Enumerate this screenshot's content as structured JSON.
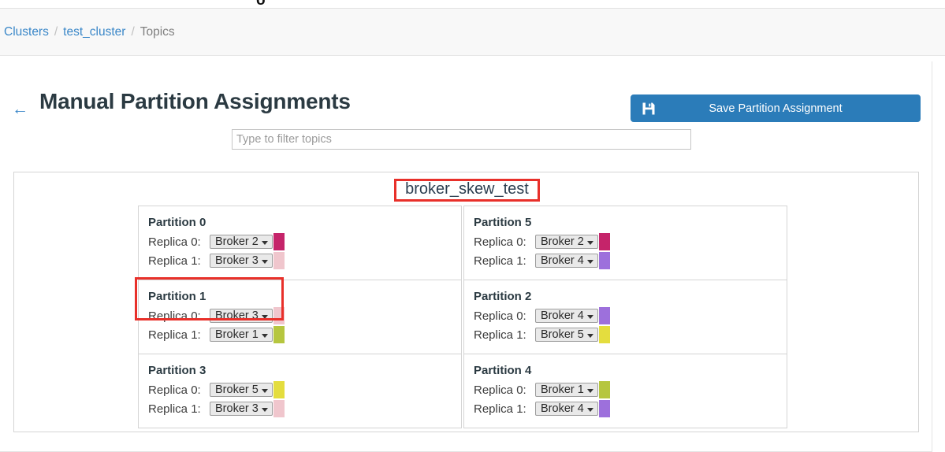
{
  "topnav": {
    "logo_glyph": "o",
    "caret_icon": "chevron-down-icon"
  },
  "breadcrumb": {
    "items": [
      {
        "label": "Clusters",
        "type": "link"
      },
      {
        "label": "test_cluster",
        "type": "link"
      },
      {
        "label": "Topics",
        "type": "current"
      }
    ],
    "separator": "/"
  },
  "header": {
    "back_icon": "←",
    "title": "Manual Partition Assignments",
    "save_button": {
      "label": "Save Partition Assignment",
      "icon": "save-icon",
      "color": "#2b7cb9"
    }
  },
  "filter": {
    "placeholder": "Type to filter topics",
    "value": ""
  },
  "topic": {
    "name": "broker_skew_test",
    "annotated": true,
    "annotation_color": "#e8302a"
  },
  "broker_colors": {
    "Broker 1": "#b6c63f",
    "Broker 2": "#c5246a",
    "Broker 3": "#f0c6cd",
    "Broker 4": "#9d70dc",
    "Broker 5": "#e4dd3e"
  },
  "broker_options": [
    "Broker 1",
    "Broker 2",
    "Broker 3",
    "Broker 4",
    "Broker 5"
  ],
  "columns": [
    {
      "side": "left",
      "partitions": [
        {
          "title": "Partition 0",
          "annotated": false,
          "replicas": [
            {
              "label": "Replica 0:",
              "broker": "Broker 2",
              "color": "#c5246a"
            },
            {
              "label": "Replica 1:",
              "broker": "Broker 3",
              "color": "#f0c6cd"
            }
          ]
        },
        {
          "title": "Partition 1",
          "annotated": true,
          "replicas": [
            {
              "label": "Replica 0:",
              "broker": "Broker 3",
              "color": "#f0c6cd"
            },
            {
              "label": "Replica 1:",
              "broker": "Broker 1",
              "color": "#b6c63f"
            }
          ]
        },
        {
          "title": "Partition 3",
          "annotated": false,
          "replicas": [
            {
              "label": "Replica 0:",
              "broker": "Broker 5",
              "color": "#e4dd3e"
            },
            {
              "label": "Replica 1:",
              "broker": "Broker 3",
              "color": "#f0c6cd"
            }
          ]
        }
      ]
    },
    {
      "side": "right",
      "partitions": [
        {
          "title": "Partition 5",
          "annotated": false,
          "replicas": [
            {
              "label": "Replica 0:",
              "broker": "Broker 2",
              "color": "#c5246a"
            },
            {
              "label": "Replica 1:",
              "broker": "Broker 4",
              "color": "#9d70dc"
            }
          ]
        },
        {
          "title": "Partition 2",
          "annotated": false,
          "replicas": [
            {
              "label": "Replica 0:",
              "broker": "Broker 4",
              "color": "#9d70dc"
            },
            {
              "label": "Replica 1:",
              "broker": "Broker 5",
              "color": "#e4dd3e"
            }
          ]
        },
        {
          "title": "Partition 4",
          "annotated": false,
          "replicas": [
            {
              "label": "Replica 0:",
              "broker": "Broker 1",
              "color": "#b6c63f"
            },
            {
              "label": "Replica 1:",
              "broker": "Broker 4",
              "color": "#9d70dc"
            }
          ]
        }
      ]
    }
  ]
}
